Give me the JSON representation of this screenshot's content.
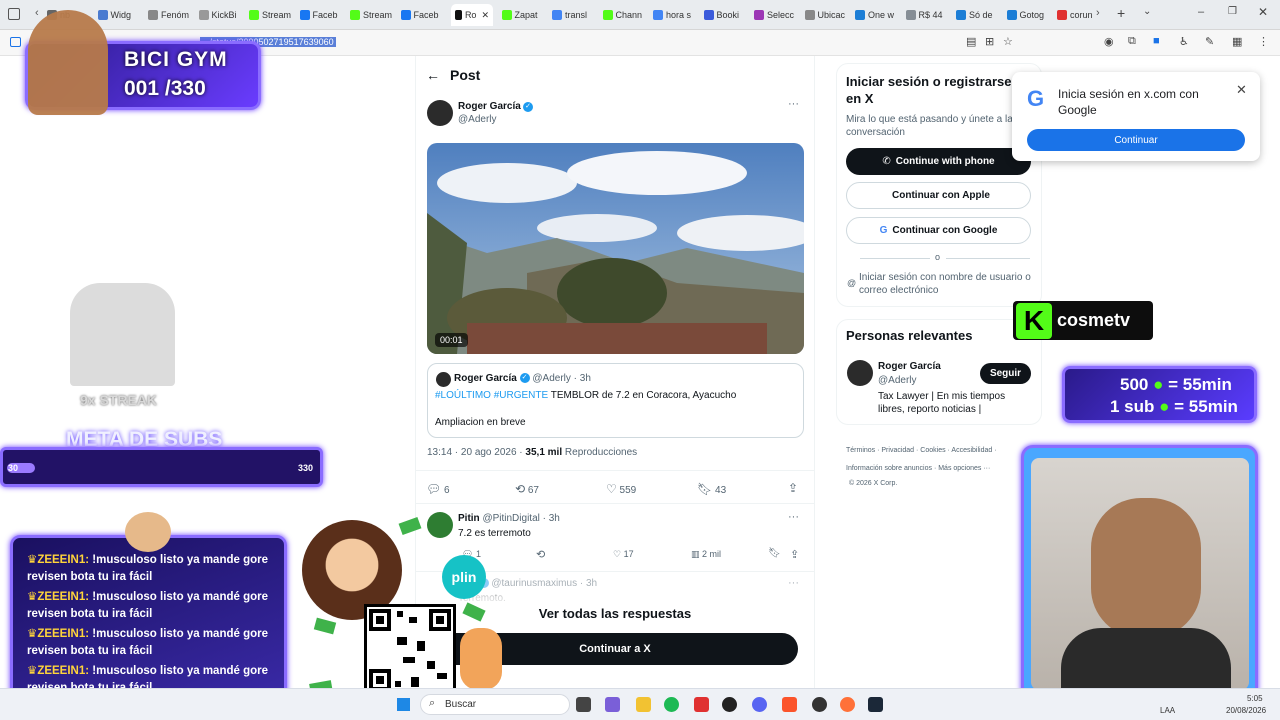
{
  "browser": {
    "tabs": [
      {
        "label": "nb",
        "color": "#666"
      },
      {
        "label": "Widg",
        "color": "#4a7bd0"
      },
      {
        "label": "Fenóm",
        "color": "#888"
      },
      {
        "label": "KickBi",
        "color": "#999"
      },
      {
        "label": "Stream",
        "color": "#53fc18"
      },
      {
        "label": "Faceb",
        "color": "#1877f2"
      },
      {
        "label": "Stream",
        "color": "#53fc18"
      },
      {
        "label": "Faceb",
        "color": "#1877f2"
      },
      {
        "label": "Ro",
        "color": "#111"
      },
      {
        "label": "Zapat",
        "color": "#53fc18"
      },
      {
        "label": "transl",
        "color": "#4285f4"
      },
      {
        "label": "Chann",
        "color": "#53fc18"
      },
      {
        "label": "hora s",
        "color": "#4285f4"
      },
      {
        "label": "Booki",
        "color": "#3b5bdb"
      },
      {
        "label": "Selecc",
        "color": "#9c36b5"
      },
      {
        "label": "Ubicac",
        "color": "#888"
      },
      {
        "label": "One w",
        "color": "#1c7ed6"
      },
      {
        "label": "R$ 44",
        "color": "#868e96"
      },
      {
        "label": "Só de",
        "color": "#1c7ed6"
      },
      {
        "label": "Gotog",
        "color": "#1c7ed6"
      },
      {
        "label": "corun",
        "color": "#e03131"
      }
    ],
    "url": ".../status/2090502719517639060"
  },
  "overlay": {
    "bici_gym_title": "BICI GYM",
    "bici_gym_count": "001 /330",
    "streak": "9x STREAK",
    "meta_subs": "META DE SUBS",
    "subs_progress": {
      "current": "30",
      "goal": "330",
      "fraction": 0.09
    },
    "kick_name": "cosmetv",
    "kick_line1": "500",
    "kick_line1b": "= 55min",
    "kick_line2": "1 sub",
    "kick_line2b": "= 55min",
    "plin": "plin",
    "chat": [
      {
        "user": "ZEEEIN1:",
        "msg": "!musculoso listo ya mande gore revisen bota tu ira fácil"
      },
      {
        "user": "ZEEEIN1:",
        "msg": "!musculoso listo ya mandé gore revisen bota tu ira fácil"
      },
      {
        "user": "ZEEEIN1:",
        "msg": "!musculoso listo ya mandé gore revisen bota tu ira fácil"
      },
      {
        "user": "ZEEEIN1:",
        "msg": "!musculoso listo ya mandé gore revisen bota tu ira fácil"
      }
    ]
  },
  "post": {
    "header": "Post",
    "author_name": "Roger García",
    "author_handle": "@Aderly",
    "video_time": "00:01",
    "quote": {
      "name": "Roger García",
      "handle": "@Aderly",
      "age": "· 3h",
      "hashtag1": "#LOÚLTIMO",
      "hashtag2": "#URGENTE",
      "text": "TEMBLOR de 7.2 en Coracora, Ayacucho",
      "text2": "Ampliacion en breve"
    },
    "timestamp": "13:14 · 20 ago 2026 · ",
    "views_count": "35,1 mil",
    "views_label": "Reproducciones",
    "stats": {
      "replies": "6",
      "reposts": "67",
      "likes": "559",
      "bookmarks": "43"
    },
    "reply1": {
      "name": "Pitin",
      "handle": "@PitinDigital",
      "age": "· 3h",
      "text": "7.2 es terremoto",
      "replies": "1",
      "likes": "17",
      "views": "2 mil"
    },
    "reply2": {
      "name": "nus",
      "handle": "@taurinusmaximus",
      "age": "· 3h",
      "text": "Terremoto."
    },
    "see_all": "Ver todas las respuestas",
    "continue_x": "Continuar a X"
  },
  "sidebar": {
    "login_title": "Iniciar sesión o registrarse en X",
    "login_sub": "Mira lo que está pasando y únete a la conversación",
    "btn_phone": "Continue with phone",
    "btn_apple": "Continuar con Apple",
    "btn_google": "Continuar con Google",
    "or": "o",
    "login_username": "Iniciar sesión con nombre de usuario o correo electrónico",
    "relevant_title": "Personas relevantes",
    "person_name": "Roger García",
    "person_handle": "@Aderly",
    "person_bio": "Tax Lawyer | En mis tiempos libres, reporto noticias |",
    "follow": "Seguir",
    "footer1": "Términos · Privacidad · Cookies · Accesibilidad ·",
    "footer2": "Información sobre anuncios · Más opciones ···",
    "footer3": "© 2026 X Corp."
  },
  "google_popup": {
    "title": "Inicia sesión en x.com con Google",
    "button": "Continuar"
  },
  "taskbar": {
    "search": "Buscar",
    "lang": "LAA",
    "time": "5:05",
    "date": "20/08/2026"
  },
  "colors": {
    "x_blue": "#1d9bf0",
    "kick_green": "#53fc18",
    "google_blue": "#1a73e8",
    "neon": "#8a6cff"
  }
}
